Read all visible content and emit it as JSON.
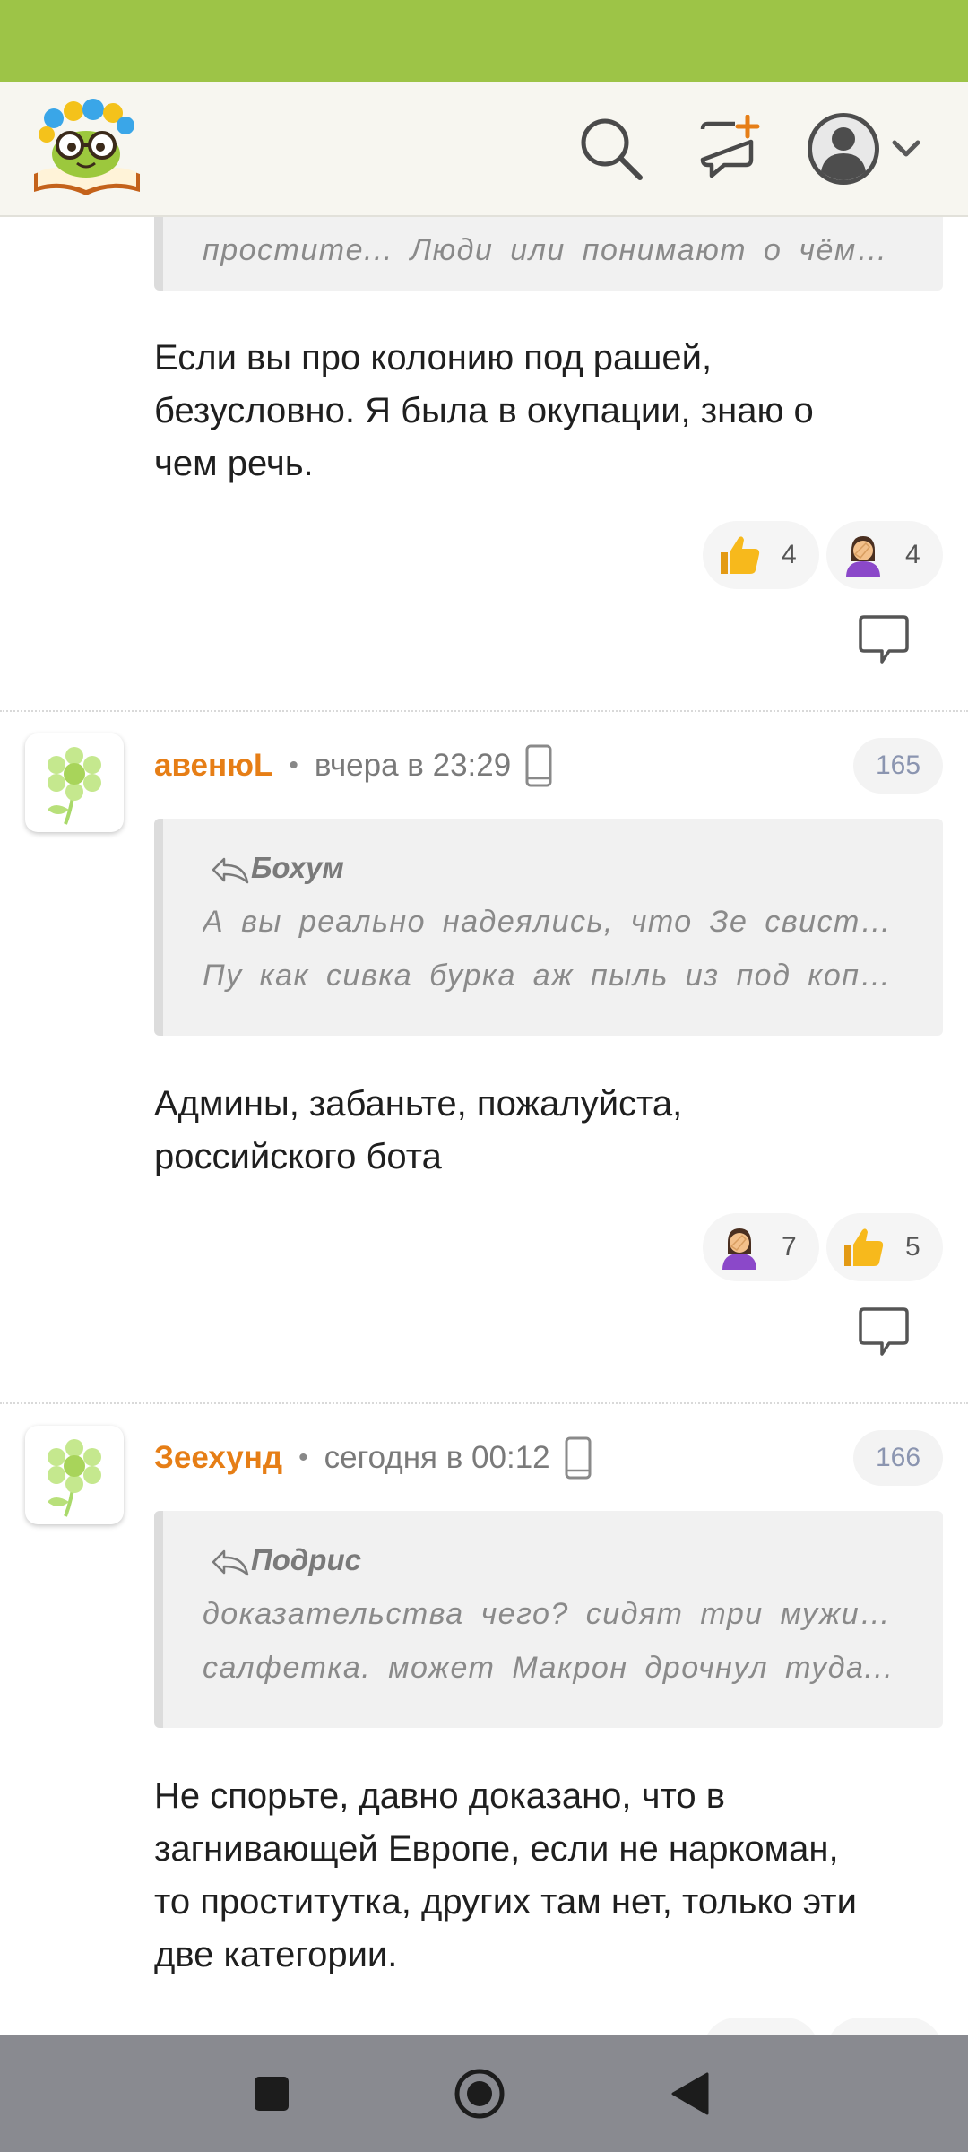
{
  "header": {
    "logo_icon": "bookworm-logo",
    "search_icon": "search-icon",
    "new_post_icon": "new-post-icon",
    "profile_icon": "avatar-icon",
    "accent": "#9dc447"
  },
  "comments": [
    {
      "partial": true,
      "quote_last_line": "простите... Люди или понимают о чём реч...",
      "text_lines": [
        "Если вы про колонию под рашей,",
        "безусловно. Я была в окупации, знаю о",
        "чем речь."
      ],
      "reactions": [
        {
          "emoji": "thumbs-up",
          "count": "4"
        },
        {
          "emoji": "facepalm",
          "count": "4"
        }
      ]
    },
    {
      "username": "авенюL",
      "time": "вчера в 23:29",
      "number": "165",
      "quote_author": "Бохум",
      "quote_lines": [
        "А вы реально надеялись, что Зе свистнет и",
        "Пу как сивка бурка аж пыль из под копы..."
      ],
      "text_lines": [
        "Админы, забаньте, пожалуйста,",
        "российского бота"
      ],
      "reactions": [
        {
          "emoji": "facepalm",
          "count": "7"
        },
        {
          "emoji": "thumbs-up",
          "count": "5"
        }
      ]
    },
    {
      "username": "Зеехунд",
      "time": "сегодня в 00:12",
      "number": "166",
      "quote_author": "Подрис",
      "quote_lines": [
        "доказательства чего? сидят три мужика и",
        "салфетка. может Макрон дрочнул туда..."
      ],
      "text_lines": [
        "Не спорьте, давно доказано, что в",
        "загнивающей Европе, если не наркоман,",
        "то проститутка, других там нет, только эти",
        "две категории."
      ]
    }
  ],
  "navbar": {
    "icons": [
      "recent-apps-icon",
      "home-icon",
      "back-icon"
    ]
  },
  "colors": {
    "username": "#e67e16",
    "badge": "#8b95b0",
    "navbar": "#898a90"
  }
}
